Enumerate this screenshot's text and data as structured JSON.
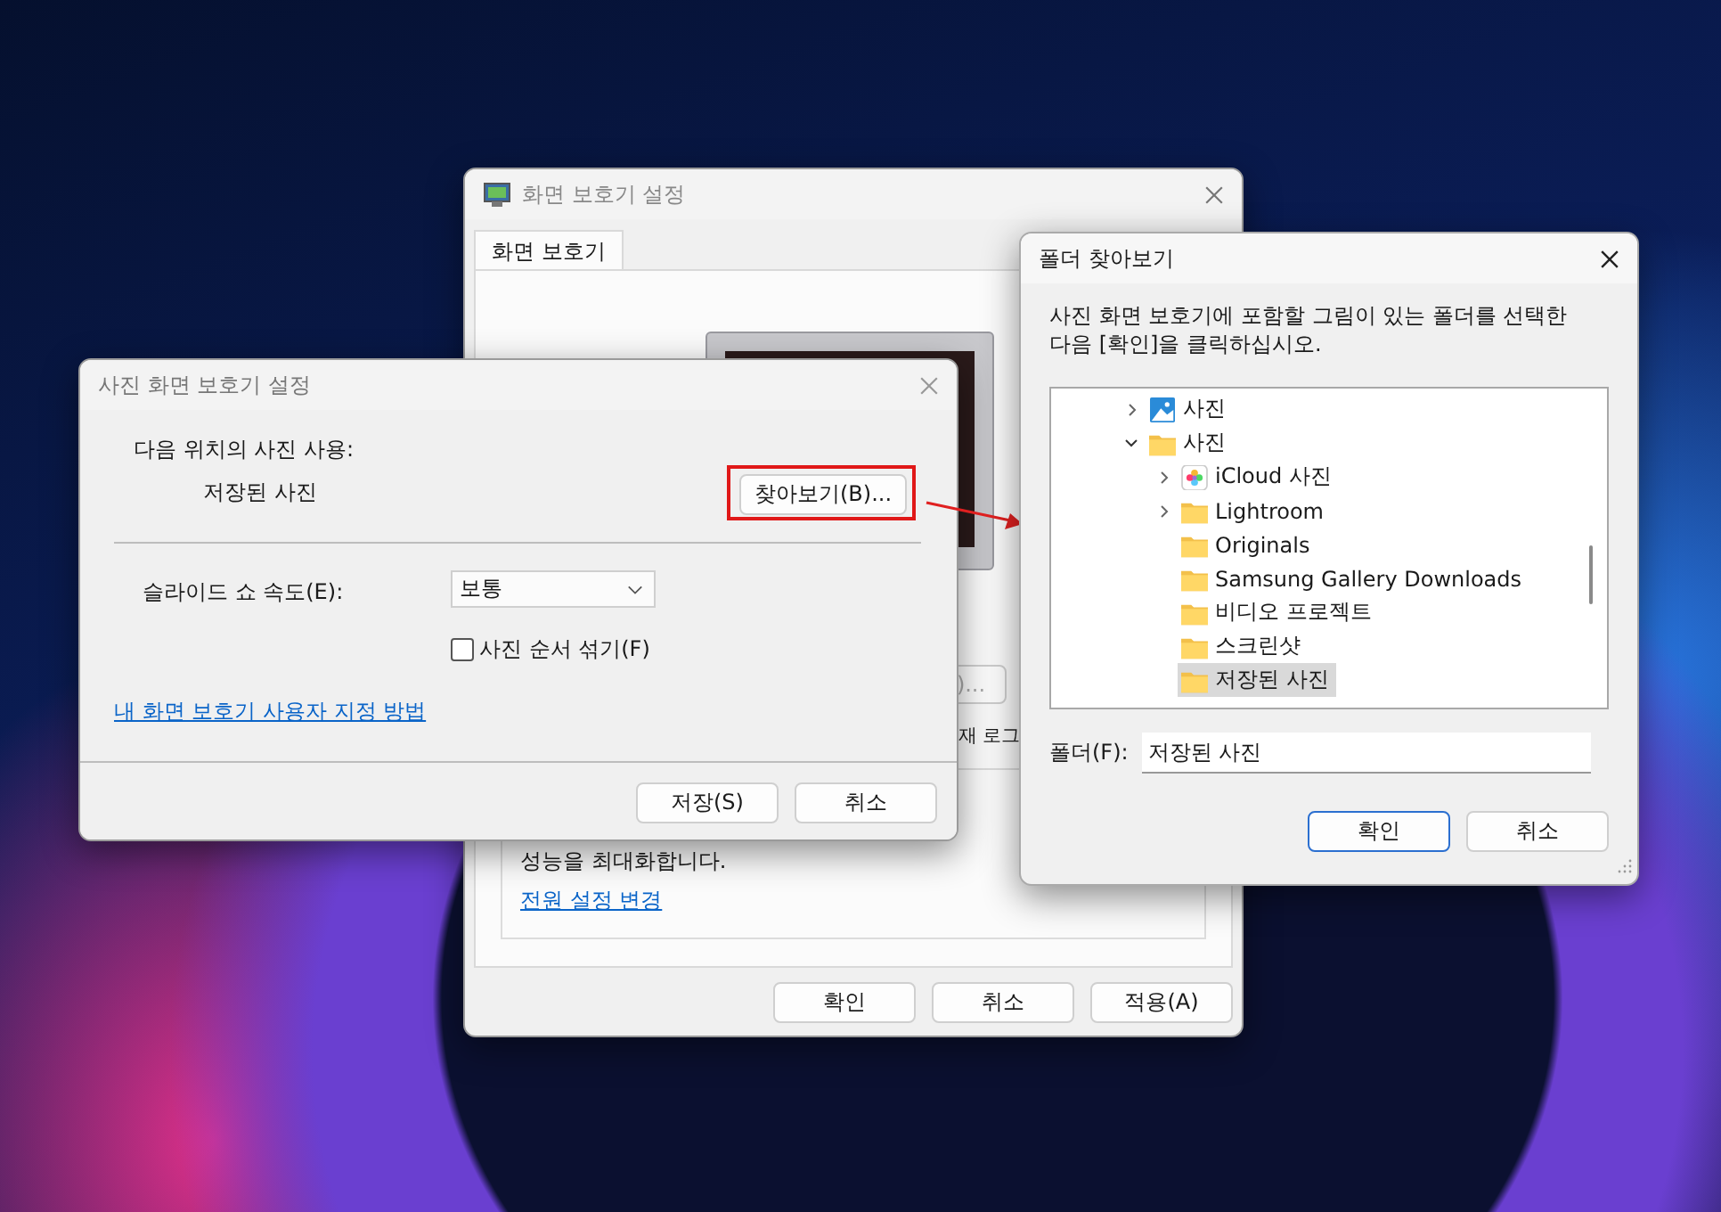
{
  "screensaver_window": {
    "title": "화면 보호기 설정",
    "tabs": [
      {
        "label": "화면 보호기",
        "selected": true
      }
    ],
    "partial_button": ")...",
    "logon_fragment": "재 로그",
    "power_text": "성능을 최대화합니다.",
    "power_link": "전원 설정 변경",
    "buttons": [
      "확인",
      "취소",
      "적용(A)"
    ]
  },
  "photo_settings_dialog": {
    "title": "사진 화면 보호기 설정",
    "source_label": "다음 위치의 사진 사용:",
    "source_value": "저장된 사진",
    "browse_button": {
      "label": "찾아보기(B)...",
      "highlighted": true
    },
    "speed_label": "슬라이드 쇼 속도(E):",
    "speed_value": "보통",
    "shuffle": {
      "label": "사진 순서 섞기(F)",
      "checked": false
    },
    "help_link": "내 화면 보호기 사용자 지정 방법",
    "buttons": [
      "저장(S)",
      "취소"
    ]
  },
  "folder_dialog": {
    "title": "폴더 찾아보기",
    "description": "사진 화면 보호기에 포함할 그림이 있는 폴더를 선택한 다음 [확인]을 클릭하십시오.",
    "tree": [
      {
        "label": "사진",
        "kind": "pictures",
        "expanded": false,
        "selected": false
      },
      {
        "label": "사진",
        "kind": "folder",
        "expanded": true,
        "selected": false,
        "children": [
          {
            "label": "iCloud 사진",
            "kind": "photos-app",
            "expanded": false,
            "selected": false
          },
          {
            "label": "Lightroom",
            "kind": "folder",
            "expanded": false,
            "selected": false
          },
          {
            "label": "Originals",
            "kind": "folder",
            "selected": false
          },
          {
            "label": "Samsung Gallery Downloads",
            "kind": "folder",
            "selected": false
          },
          {
            "label": "비디오 프로젝트",
            "kind": "folder",
            "selected": false
          },
          {
            "label": "스크린샷",
            "kind": "folder",
            "selected": false
          },
          {
            "label": "저장된 사진",
            "kind": "folder",
            "selected": true
          }
        ]
      }
    ],
    "folder_label": "폴더(F):",
    "folder_value": "저장된 사진",
    "buttons": [
      {
        "label": "확인",
        "default": true
      },
      {
        "label": "취소",
        "default": false
      }
    ]
  }
}
